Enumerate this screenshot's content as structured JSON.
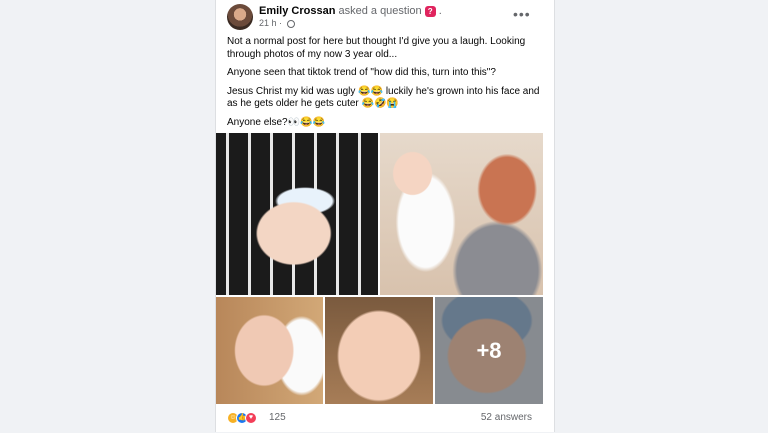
{
  "post": {
    "author": "Emily Crossan",
    "action": "asked a question",
    "time": "21 h",
    "more_icon": "more-dots-icon",
    "paragraphs": [
      "Not a normal post for here but thought I'd give you a laugh. Looking through photos of my now 3 year old...",
      "Anyone seen that tiktok trend of \"how did this, turn into this\"?",
      "Jesus Christ my kid was ugly 😂😂 luckily he's grown into his face and as he gets older he gets cuter 😂🤣😭",
      "Anyone else?👀😂😂"
    ],
    "more_photos": "+8"
  },
  "footer": {
    "reaction_count": "125",
    "answers": "52 answers"
  },
  "colors": {
    "background": "#f0f2f5",
    "card": "#ffffff",
    "muted_text": "#65676b",
    "question_icon": "#e0245e",
    "like_blue": "#1877f2"
  }
}
